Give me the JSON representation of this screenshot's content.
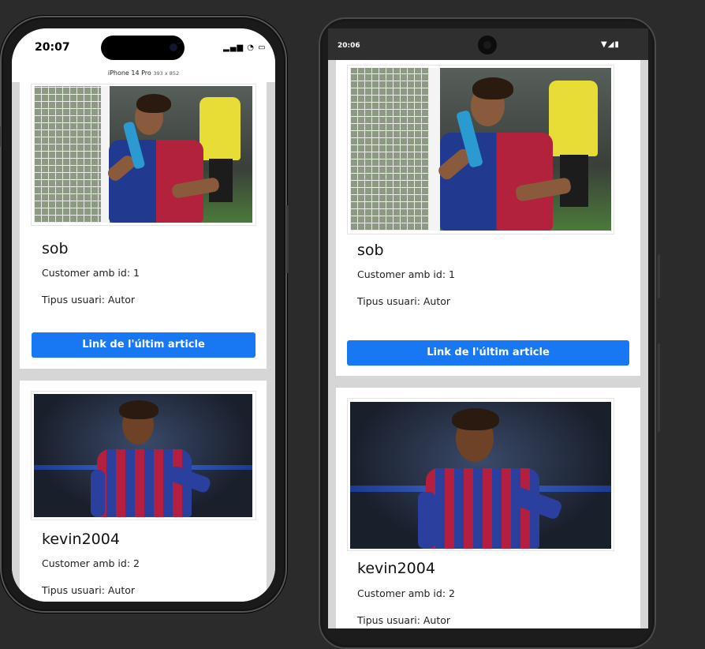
{
  "iphone": {
    "time": "20:07",
    "status_icons": "▂▄▆ ◔ ▭",
    "device_name": "iPhone 14 Pro",
    "device_size": "393 x 852"
  },
  "android": {
    "time": "20:06",
    "status_icons": "▼◢▮"
  },
  "cards": [
    {
      "username": "sob",
      "id_label": "Customer amb id: 1",
      "type_label": "Tipus usuari: Autor",
      "button_label": "Link de l'últim article"
    },
    {
      "username": "kevin2004",
      "id_label": "Customer amb id: 2",
      "type_label": "Tipus usuari: Autor"
    }
  ],
  "colors": {
    "button": "#1877f2",
    "background": "#2b2b2b"
  }
}
